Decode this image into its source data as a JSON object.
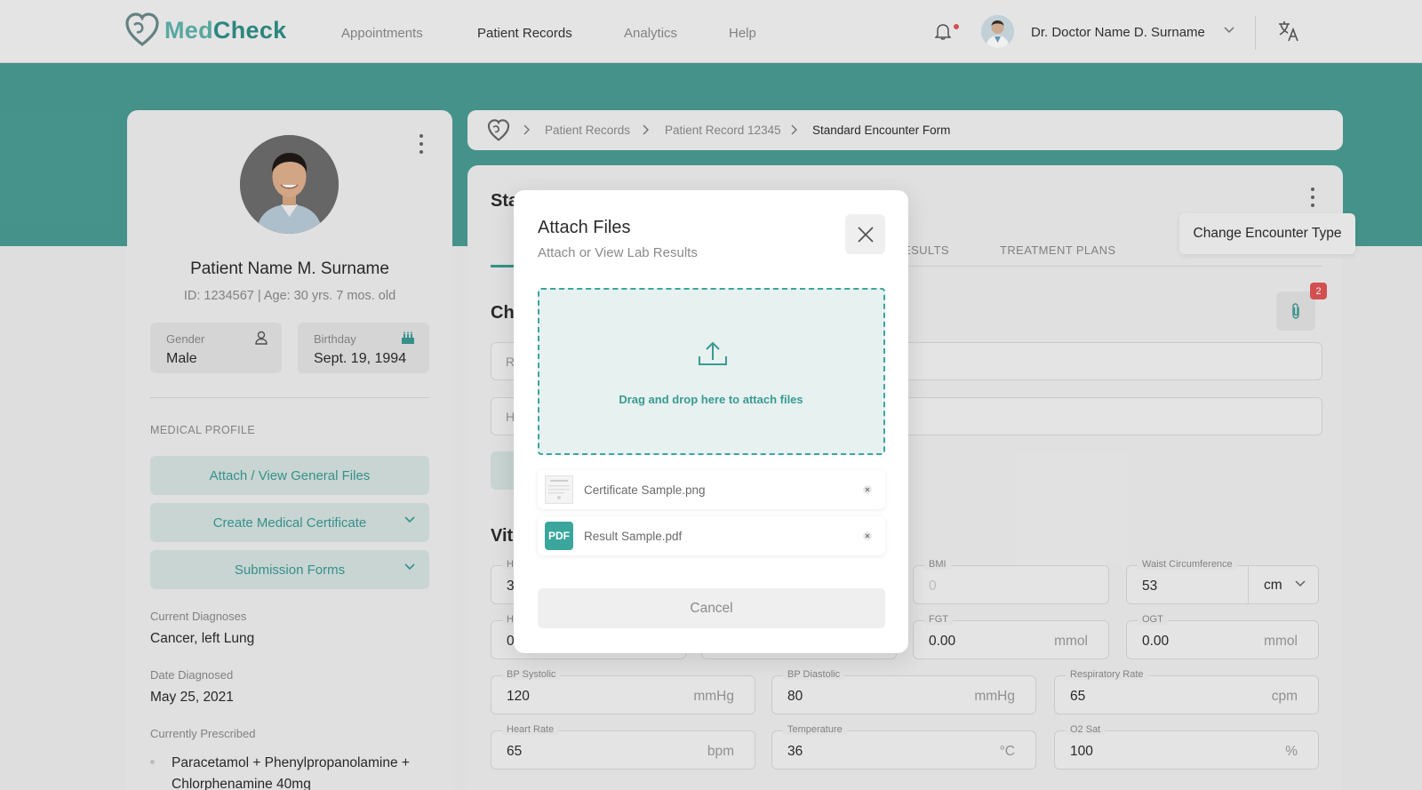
{
  "app": {
    "name_part1": "Med",
    "name_part2": "Check"
  },
  "nav": [
    "Appointments",
    "Patient Records",
    "Analytics",
    "Help"
  ],
  "user": {
    "name": "Dr. Doctor Name D. Surname"
  },
  "patient": {
    "name": "Patient Name M. Surname",
    "meta": "ID: 1234567  |  Age: 30 yrs. 7 mos. old",
    "gender_label": "Gender",
    "gender": "Male",
    "birthday_label": "Birthday",
    "birthday": "Sept. 19, 1994",
    "section_title": "MEDICAL PROFILE",
    "buttons": [
      "Attach / View General Files",
      "Create Medical Certificate",
      "Submission Forms"
    ],
    "diagnoses_label": "Current Diagnoses",
    "diagnoses": "Cancer, left Lung",
    "date_label": "Date Diagnosed",
    "date": "May 25, 2021",
    "prescribed_label": "Currently Prescribed",
    "prescribed": "Paracetamol + Phenylpropanolamine + Chlorphenamine 40mg"
  },
  "breadcrumb": [
    "Patient Records",
    "Patient Record 12345",
    "Standard Encounter Form"
  ],
  "form": {
    "title_visible": "Sta",
    "tabs_visible": [
      "ESULTS",
      "TREATMENT PLANS"
    ],
    "section1_visible": "Ch",
    "section2_visible": "Vit",
    "input1_visible": "R",
    "input2_visible": "H",
    "attachment_count": "2",
    "row1_partials": [
      {
        "label": "H",
        "value": "3"
      }
    ],
    "row2_partials": [
      {
        "label": "H",
        "value": "0"
      }
    ],
    "vitals": {
      "bmi": {
        "label": "BMI",
        "placeholder": "0"
      },
      "waist": {
        "label": "Waist Circumference",
        "value": "53",
        "unit": "cm"
      },
      "fgt": {
        "label": "FGT",
        "value": "0.00",
        "unit": "mmol"
      },
      "ogt": {
        "label": "OGT",
        "value": "0.00",
        "unit": "mmol"
      },
      "bp_sys": {
        "label": "BP Systolic",
        "value": "120",
        "unit": "mmHg"
      },
      "bp_dia": {
        "label": "BP Diastolic",
        "value": "80",
        "unit": "mmHg"
      },
      "resp": {
        "label": "Respiratory Rate",
        "value": "65",
        "unit": "cpm"
      },
      "hr": {
        "label": "Heart Rate",
        "value": "65",
        "unit": "bpm"
      },
      "temp": {
        "label": "Temperature",
        "value": "36",
        "unit": "°C"
      },
      "o2": {
        "label": "O2 Sat",
        "value": "100",
        "unit": "%"
      }
    }
  },
  "tooltip": "Change Encounter Type",
  "modal": {
    "title": "Attach Files",
    "subtitle": "Attach or View Lab Results",
    "dropzone_text": "Drag and drop here to attach files",
    "files": [
      {
        "name": "Certificate Sample.png",
        "type": "image"
      },
      {
        "name": "Result Sample.pdf",
        "type": "pdf",
        "badge": "PDF"
      }
    ],
    "cancel": "Cancel"
  },
  "colors": {
    "accent": "#3a9a91",
    "band": "#4a9c94",
    "badge": "#e05656"
  }
}
